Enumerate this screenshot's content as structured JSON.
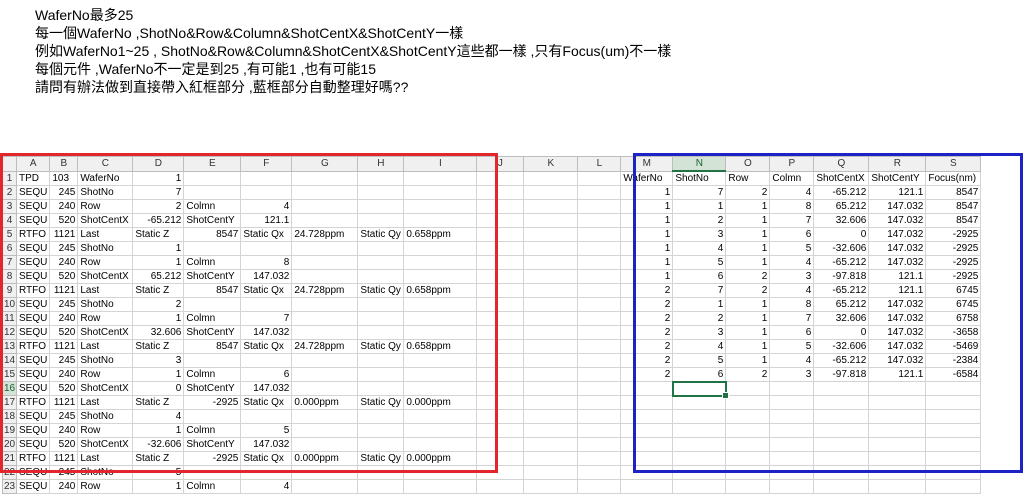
{
  "question": {
    "lines": [
      "WaferNo最多25",
      "每一個WaferNo ,ShotNo&Row&Column&ShotCentX&ShotCentY一樣",
      "例如WaferNo1~25 , ShotNo&Row&Column&ShotCentX&ShotCentY這些都一樣 ,只有Focus(um)不一樣",
      "每個元件 ,WaferNo不一定是到25 ,有可能1 ,也有可能15",
      "請問有辦法做到直接帶入紅框部分 ,藍框部分自動整理好嗎??"
    ]
  },
  "sheet": {
    "columns": [
      "A",
      "B",
      "C",
      "D",
      "E",
      "F",
      "G",
      "H",
      "I",
      "J",
      "K",
      "L",
      "M",
      "N",
      "O",
      "P",
      "Q",
      "R",
      "S"
    ],
    "selected_column": "N",
    "selected_row": 16,
    "rows": [
      {
        "n": "1",
        "cells": [
          "TPD",
          "103",
          "WaferNo",
          "1",
          "",
          "",
          "",
          "",
          "",
          "",
          "",
          "",
          "WaferNo",
          "ShotNo",
          "Row",
          "Colmn",
          "ShotCentX",
          "ShotCentY",
          "Focus(nm)"
        ]
      },
      {
        "n": "2",
        "cells": [
          "SEQU",
          "245",
          "ShotNo",
          "7",
          "",
          "",
          "",
          "",
          "",
          "",
          "",
          "",
          "1",
          "7",
          "2",
          "4",
          "-65.212",
          "121.1",
          "8547"
        ]
      },
      {
        "n": "3",
        "cells": [
          "SEQU",
          "240",
          "Row",
          "2",
          "Colmn",
          "4",
          "",
          "",
          "",
          "",
          "",
          "",
          "1",
          "1",
          "1",
          "8",
          "65.212",
          "147.032",
          "8547"
        ]
      },
      {
        "n": "4",
        "cells": [
          "SEQU",
          "520",
          "ShotCentX",
          "-65.212",
          "ShotCentY",
          "121.1",
          "",
          "",
          "",
          "",
          "",
          "",
          "1",
          "2",
          "1",
          "7",
          "32.606",
          "147.032",
          "8547"
        ]
      },
      {
        "n": "5",
        "cells": [
          "RTFO",
          "1121",
          "Last",
          "Static  Z",
          "8547",
          "Static  Qx",
          "24.728ppm",
          "Static  Qy",
          "0.658ppm",
          "",
          "",
          "",
          "1",
          "3",
          "1",
          "6",
          "0",
          "147.032",
          "-2925"
        ]
      },
      {
        "n": "6",
        "cells": [
          "SEQU",
          "245",
          "ShotNo",
          "1",
          "",
          "",
          "",
          "",
          "",
          "",
          "",
          "",
          "1",
          "4",
          "1",
          "5",
          "-32.606",
          "147.032",
          "-2925"
        ]
      },
      {
        "n": "7",
        "cells": [
          "SEQU",
          "240",
          "Row",
          "1",
          "Colmn",
          "8",
          "",
          "",
          "",
          "",
          "",
          "",
          "1",
          "5",
          "1",
          "4",
          "-65.212",
          "147.032",
          "-2925"
        ]
      },
      {
        "n": "8",
        "cells": [
          "SEQU",
          "520",
          "ShotCentX",
          "65.212",
          "ShotCentY",
          "147.032",
          "",
          "",
          "",
          "",
          "",
          "",
          "1",
          "6",
          "2",
          "3",
          "-97.818",
          "121.1",
          "-2925"
        ]
      },
      {
        "n": "9",
        "cells": [
          "RTFO",
          "1121",
          "Last",
          "Static  Z",
          "8547",
          "Static  Qx",
          "24.728ppm",
          "Static  Qy",
          "0.658ppm",
          "",
          "",
          "",
          "2",
          "7",
          "2",
          "4",
          "-65.212",
          "121.1",
          "6745"
        ]
      },
      {
        "n": "10",
        "cells": [
          "SEQU",
          "245",
          "ShotNo",
          "2",
          "",
          "",
          "",
          "",
          "",
          "",
          "",
          "",
          "2",
          "1",
          "1",
          "8",
          "65.212",
          "147.032",
          "6745"
        ]
      },
      {
        "n": "11",
        "cells": [
          "SEQU",
          "240",
          "Row",
          "1",
          "Colmn",
          "7",
          "",
          "",
          "",
          "",
          "",
          "",
          "2",
          "2",
          "1",
          "7",
          "32.606",
          "147.032",
          "6758"
        ]
      },
      {
        "n": "12",
        "cells": [
          "SEQU",
          "520",
          "ShotCentX",
          "32.606",
          "ShotCentY",
          "147.032",
          "",
          "",
          "",
          "",
          "",
          "",
          "2",
          "3",
          "1",
          "6",
          "0",
          "147.032",
          "-3658"
        ]
      },
      {
        "n": "13",
        "cells": [
          "RTFO",
          "1121",
          "Last",
          "Static  Z",
          "8547",
          "Static  Qx",
          "24.728ppm",
          "Static  Qy",
          "0.658ppm",
          "",
          "",
          "",
          "2",
          "4",
          "1",
          "5",
          "-32.606",
          "147.032",
          "-5469"
        ]
      },
      {
        "n": "14",
        "cells": [
          "SEQU",
          "245",
          "ShotNo",
          "3",
          "",
          "",
          "",
          "",
          "",
          "",
          "",
          "",
          "2",
          "5",
          "1",
          "4",
          "-65.212",
          "147.032",
          "-2384"
        ]
      },
      {
        "n": "15",
        "cells": [
          "SEQU",
          "240",
          "Row",
          "1",
          "Colmn",
          "6",
          "",
          "",
          "",
          "",
          "",
          "",
          "2",
          "6",
          "2",
          "3",
          "-97.818",
          "121.1",
          "-6584"
        ]
      },
      {
        "n": "16",
        "cells": [
          "SEQU",
          "520",
          "ShotCentX",
          "0",
          "ShotCentY",
          "147.032",
          "",
          "",
          "",
          "",
          "",
          "",
          "",
          "",
          "",
          "",
          "",
          "",
          ""
        ]
      },
      {
        "n": "17",
        "cells": [
          "RTFO",
          "1121",
          "Last",
          "Static  Z",
          "-2925",
          "Static  Qx",
          "0.000ppm",
          "Static  Qy",
          "0.000ppm",
          "",
          "",
          "",
          "",
          "",
          "",
          "",
          "",
          "",
          ""
        ]
      },
      {
        "n": "18",
        "cells": [
          "SEQU",
          "245",
          "ShotNo",
          "4",
          "",
          "",
          "",
          "",
          "",
          "",
          "",
          "",
          "",
          "",
          "",
          "",
          "",
          "",
          ""
        ]
      },
      {
        "n": "19",
        "cells": [
          "SEQU",
          "240",
          "Row",
          "1",
          "Colmn",
          "5",
          "",
          "",
          "",
          "",
          "",
          "",
          "",
          "",
          "",
          "",
          "",
          "",
          ""
        ]
      },
      {
        "n": "20",
        "cells": [
          "SEQU",
          "520",
          "ShotCentX",
          "-32.606",
          "ShotCentY",
          "147.032",
          "",
          "",
          "",
          "",
          "",
          "",
          "",
          "",
          "",
          "",
          "",
          "",
          ""
        ]
      },
      {
        "n": "21",
        "cells": [
          "RTFO",
          "1121",
          "Last",
          "Static  Z",
          "-2925",
          "Static  Qx",
          "0.000ppm",
          "Static  Qy",
          "0.000ppm",
          "",
          "",
          "",
          "",
          "",
          "",
          "",
          "",
          "",
          ""
        ]
      },
      {
        "n": "22",
        "cells": [
          "SEQU",
          "245",
          "ShotNo",
          "5",
          "",
          "",
          "",
          "",
          "",
          "",
          "",
          "",
          "",
          "",
          "",
          "",
          "",
          "",
          ""
        ]
      },
      {
        "n": "23",
        "cells": [
          "SEQU",
          "240",
          "Row",
          "1",
          "Colmn",
          "4",
          "",
          "",
          "",
          "",
          "",
          "",
          "",
          "",
          "",
          "",
          "",
          "",
          ""
        ]
      }
    ]
  },
  "colors": {
    "red_frame": "#e3262b",
    "blue_frame": "#1c22c4",
    "selection": "#217346"
  }
}
